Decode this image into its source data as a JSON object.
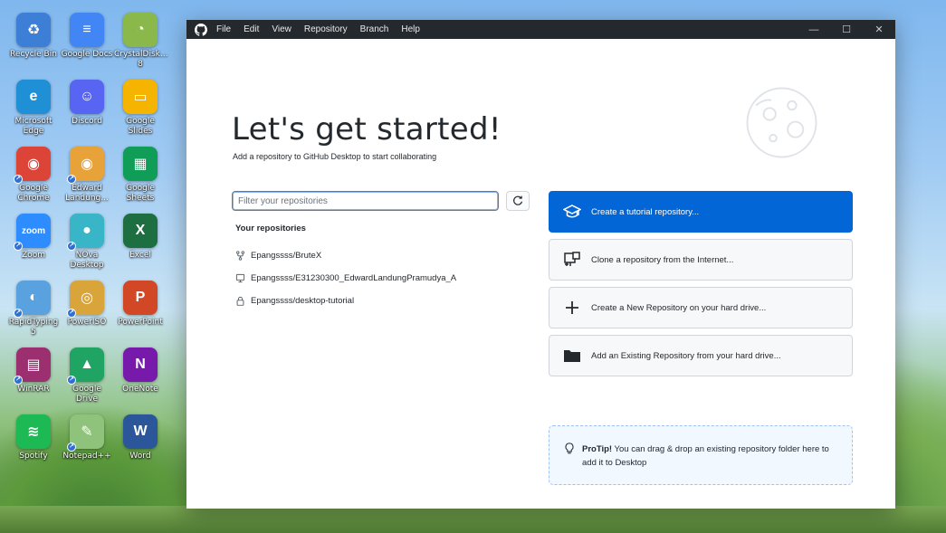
{
  "desktop": {
    "icons": [
      {
        "label": "Recycle Bin",
        "color": "#3d7fd6",
        "glyph": "♻",
        "shortcut": false
      },
      {
        "label": "Google Docs",
        "color": "#4285f4",
        "glyph": "≡",
        "shortcut": false
      },
      {
        "label": "CrystalDisk... 8",
        "color": "#8ab84a",
        "glyph": "◔",
        "shortcut": false
      },
      {
        "label": "Microsoft Edge",
        "color": "#1f8fd6",
        "glyph": "e",
        "shortcut": false
      },
      {
        "label": "Discord",
        "color": "#5865f2",
        "glyph": "☺",
        "shortcut": false
      },
      {
        "label": "Google Slides",
        "color": "#f4b400",
        "glyph": "▭",
        "shortcut": false
      },
      {
        "label": "Google Chrome",
        "color": "#db4437",
        "glyph": "◉",
        "shortcut": true
      },
      {
        "label": "Edward Landung...",
        "color": "#e8a23a",
        "glyph": "◉",
        "shortcut": true
      },
      {
        "label": "Google Sheets",
        "color": "#0f9d58",
        "glyph": "▦",
        "shortcut": false
      },
      {
        "label": "Zoom",
        "color": "#2d8cff",
        "glyph": "zoom",
        "shortcut": true
      },
      {
        "label": "NOva Desktop",
        "color": "#39b5c8",
        "glyph": "●",
        "shortcut": true
      },
      {
        "label": "Excel",
        "color": "#1d6f42",
        "glyph": "X",
        "shortcut": false
      },
      {
        "label": "RapidTyping 5",
        "color": "#5aa1e0",
        "glyph": "◐",
        "shortcut": true
      },
      {
        "label": "PowerISO",
        "color": "#d9a43a",
        "glyph": "◎",
        "shortcut": true
      },
      {
        "label": "PowerPoint",
        "color": "#d24726",
        "glyph": "P",
        "shortcut": false
      },
      {
        "label": "WinRAR",
        "color": "#9b2f6f",
        "glyph": "▤",
        "shortcut": true
      },
      {
        "label": "Google Drive",
        "color": "#1fa463",
        "glyph": "▲",
        "shortcut": true
      },
      {
        "label": "OneNote",
        "color": "#7719aa",
        "glyph": "N",
        "shortcut": false
      },
      {
        "label": "Spotify",
        "color": "#1db954",
        "glyph": "≋",
        "shortcut": false
      },
      {
        "label": "Notepad++",
        "color": "#8fc27a",
        "glyph": "✎",
        "shortcut": true
      },
      {
        "label": "Word",
        "color": "#2b579a",
        "glyph": "W",
        "shortcut": false
      }
    ]
  },
  "window": {
    "menu": [
      "File",
      "Edit",
      "View",
      "Repository",
      "Branch",
      "Help"
    ],
    "controls": {
      "minimize": "—",
      "maximize": "☐",
      "close": "✕"
    }
  },
  "welcome": {
    "title": "Let's get started!",
    "subtitle": "Add a repository to GitHub Desktop to start collaborating"
  },
  "filter": {
    "placeholder": "Filter your repositories"
  },
  "repositories": {
    "header": "Your repositories",
    "items": [
      {
        "name": "Epangssss/BruteX",
        "icon": "fork-icon"
      },
      {
        "name": "Epangssss/E31230300_EdwardLandungPramudya_A",
        "icon": "device-icon"
      },
      {
        "name": "Epangssss/desktop-tutorial",
        "icon": "lock-icon"
      }
    ]
  },
  "actions": [
    {
      "label": "Create a tutorial repository...",
      "icon": "mortarboard-icon",
      "primary": true
    },
    {
      "label": "Clone a repository from the Internet...",
      "icon": "clone-icon",
      "primary": false
    },
    {
      "label": "Create a New Repository on your hard drive...",
      "icon": "plus-icon",
      "primary": false
    },
    {
      "label": "Add an Existing Repository from your hard drive...",
      "icon": "folder-icon",
      "primary": false
    }
  ],
  "protip": {
    "label": "ProTip!",
    "text": "You can drag & drop an existing repository folder here to add it to Desktop"
  }
}
